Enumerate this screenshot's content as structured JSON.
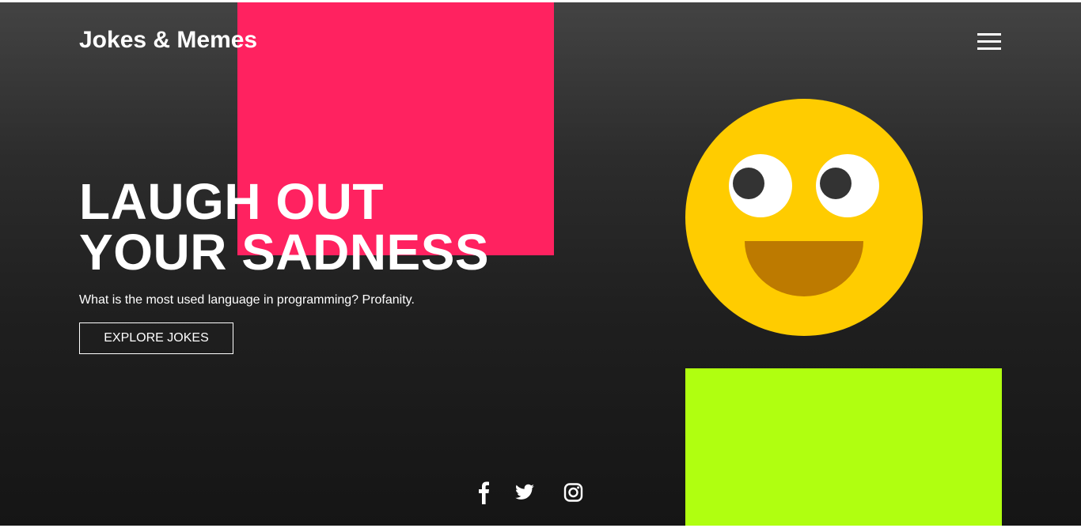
{
  "header": {
    "brand": "Jokes & Memes",
    "menu_icon": "hamburger-menu-icon"
  },
  "hero": {
    "title_line1": "LAUGH OUT",
    "title_line2": "YOUR SADNESS",
    "subtitle": "What is the most used language in programming? Profanity.",
    "cta_label": "EXPLORE JOKES"
  },
  "illustration": {
    "icon": "smiley-face-icon"
  },
  "social_links": [
    {
      "icon": "facebook-icon"
    },
    {
      "icon": "twitter-icon"
    },
    {
      "icon": "instagram-icon"
    }
  ],
  "colors": {
    "pink_accent": "#ff2260",
    "lime_accent": "#b0ff10",
    "smiley_yellow": "#ffcc00",
    "smiley_mouth": "#bd7a00",
    "eye_pupil": "#333333",
    "text": "#ffffff"
  }
}
